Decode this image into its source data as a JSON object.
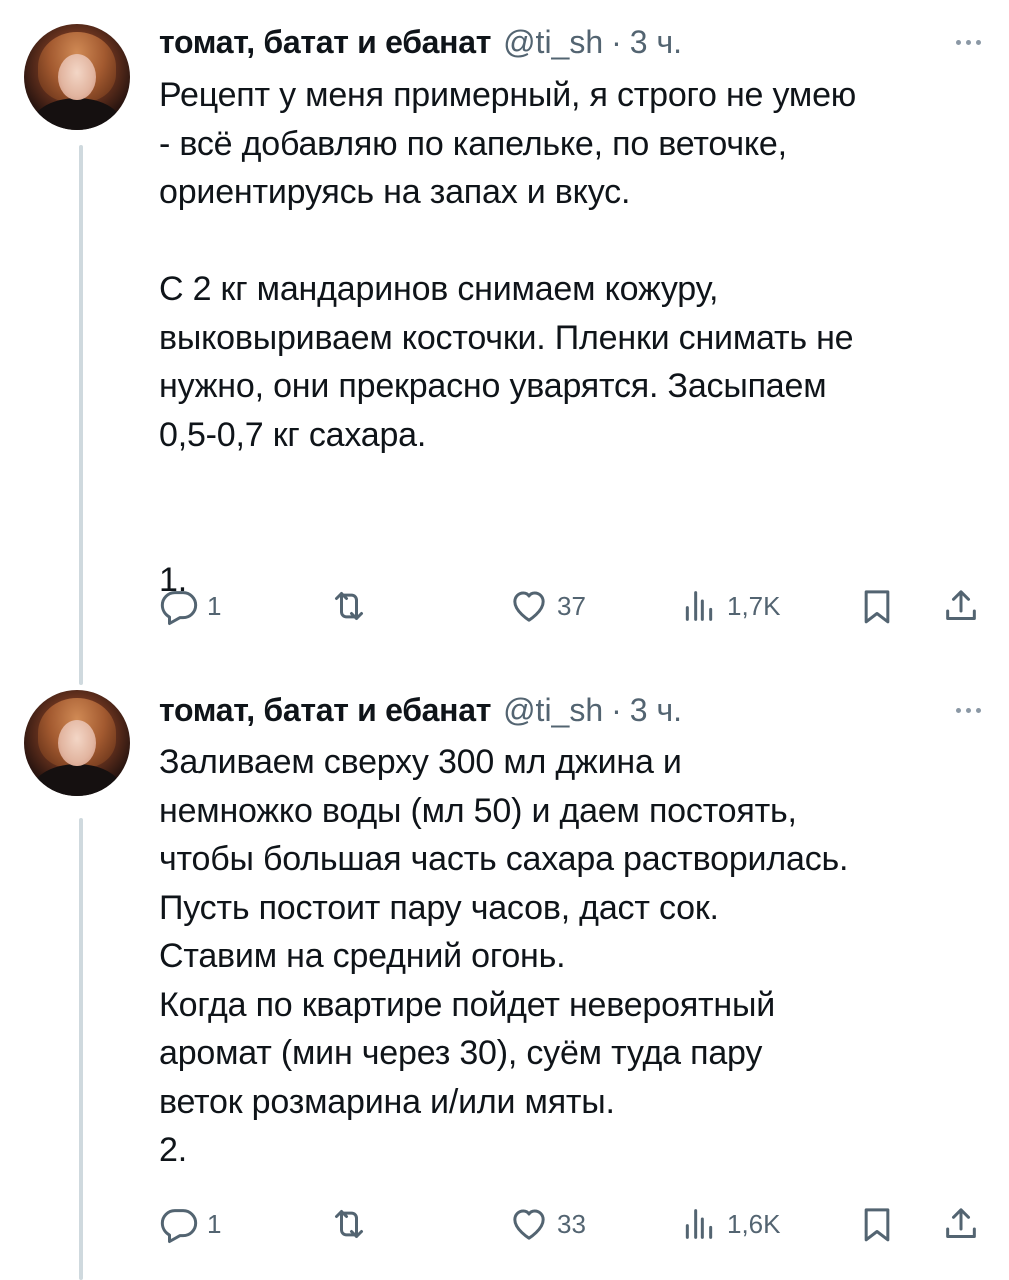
{
  "tweets": [
    {
      "author": {
        "name": "томат, батат и ебанат",
        "handle": "@ti_sh",
        "time": "3 ч.",
        "separator": "·"
      },
      "text": "Рецепт у меня примерный, я строго не умею\n- всё добавляю по капельке, по веточке,\nориентируясь на запах и вкус.\n\nС 2 кг мандаринов снимаем кожуру,\nвыковыриваем косточки. Пленки снимать не\nнужно, они прекрасно уварятся. Засыпаем\n0,5-0,7 кг сахара.\n\n\n1.",
      "stats": {
        "replies": "1",
        "retweets": "",
        "likes": "37",
        "views": "1,7K"
      }
    },
    {
      "author": {
        "name": "томат, батат и ебанат",
        "handle": "@ti_sh",
        "time": "3 ч.",
        "separator": "·"
      },
      "text": "Заливаем сверху 300 мл джина и\nнемножко воды (мл 50) и даем постоять,\nчтобы большая часть сахара растворилась.\nПусть постоит пару часов, даст сок.\nСтавим на средний огонь.\nКогда по квартире пойдет невероятный\nаромат (мин через 30), суём туда пару\nветок розмарина и/или мяты.\n2.",
      "stats": {
        "replies": "1",
        "retweets": "",
        "likes": "33",
        "views": "1,6K"
      }
    }
  ],
  "icons": [
    "reply-icon",
    "retweet-icon",
    "like-icon",
    "views-icon",
    "bookmark-icon",
    "share-icon",
    "more-icon"
  ],
  "colors": {
    "text": "#0f1419",
    "secondary": "#536471",
    "thread_line": "#cfd9de"
  }
}
